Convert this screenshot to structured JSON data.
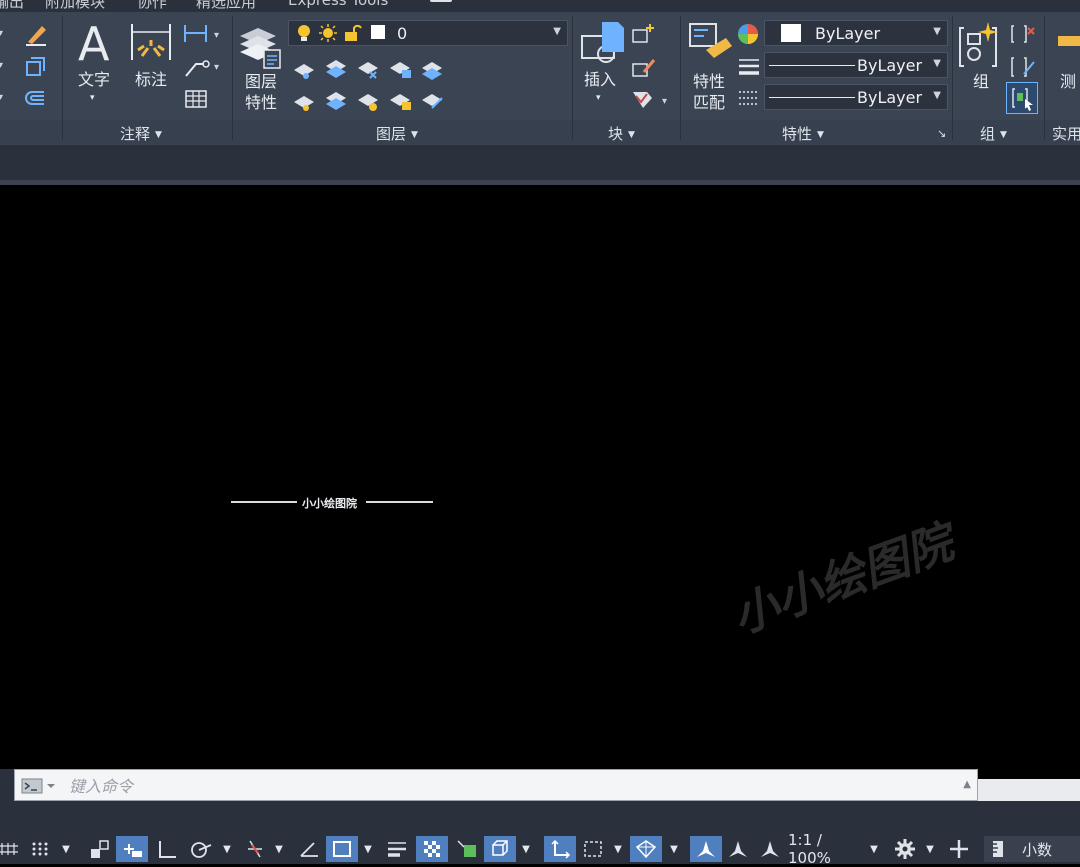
{
  "menu": {
    "items": [
      "输出",
      "附加模块",
      "协作",
      "精选应用",
      "Express Tools"
    ]
  },
  "ribbon": {
    "annotation": {
      "text_label": "文字",
      "dimension_label": "标注",
      "title": "注释"
    },
    "layers": {
      "properties_label_1": "图层",
      "properties_label_2": "特性",
      "current_layer": "0",
      "title": "图层"
    },
    "block": {
      "insert_label": "插入",
      "title": "块"
    },
    "properties": {
      "match_label_1": "特性",
      "match_label_2": "匹配",
      "color": "ByLayer",
      "linetype": "ByLayer",
      "lineweight": "ByLayer",
      "title": "特性"
    },
    "group": {
      "group_label": "组",
      "title": "组"
    },
    "utilities": {
      "measure_label": "测",
      "title": "实用"
    }
  },
  "canvas": {
    "center_label": "小小绘图院",
    "watermark": "小小绘图院"
  },
  "command": {
    "placeholder": "键入命令"
  },
  "statusbar": {
    "scale": "1:1 / 100%",
    "units": "小数"
  },
  "colors": {
    "ribbon_bg": "#3b4453",
    "dark_bg": "#2b313c",
    "accent_blue": "#4f7fbf",
    "drawing_bg": "#000000"
  }
}
